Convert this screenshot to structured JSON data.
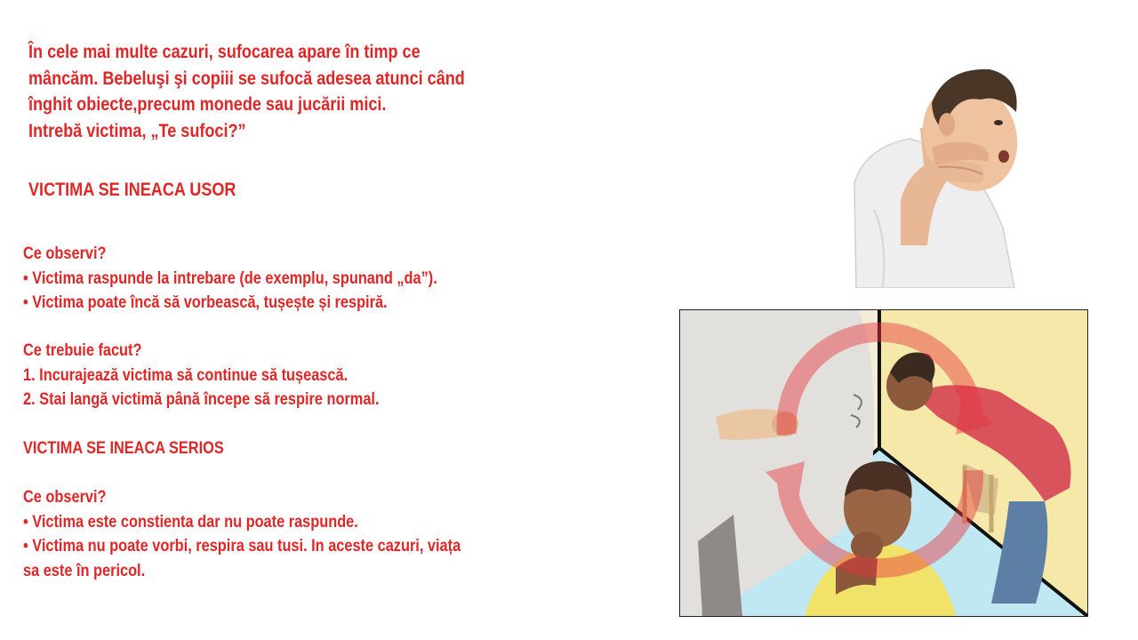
{
  "intro": {
    "lines": [
      "În cele mai multe cazuri, sufocarea apare în timp ce",
      "mâncăm. Bebeluşi şi copiii se sufocă adesea atunci când",
      "înghit obiecte,precum monede sau jucării mici.",
      "Intrebă victima, „Te sufoci?”"
    ]
  },
  "section_mild": {
    "heading": "VICTIMA SE INEACA USOR",
    "observe_title": "Ce observi?",
    "observe_items": [
      "• Victima raspunde la intrebare (de exemplu, spunand „da”).",
      "• Victima poate încă să vorbească, tușește și respiră."
    ],
    "todo_title": "Ce trebuie facut?",
    "todo_items": [
      "1. Incurajează victima să continue să tușească.",
      "2. Stai langă victimă până începe să respire normal."
    ]
  },
  "section_severe": {
    "heading": "VICTIMA SE INEACA SERIOS",
    "observe_title": "Ce observi?",
    "observe_items": [
      "• Victima este constienta dar nu poate raspunde.",
      "• Victima nu poate vorbi, respira sau tusi. In aceste cazuri, viața",
      "sa este în pericol."
    ]
  },
  "colors": {
    "text": "#e02626",
    "background": "#ffffff"
  }
}
